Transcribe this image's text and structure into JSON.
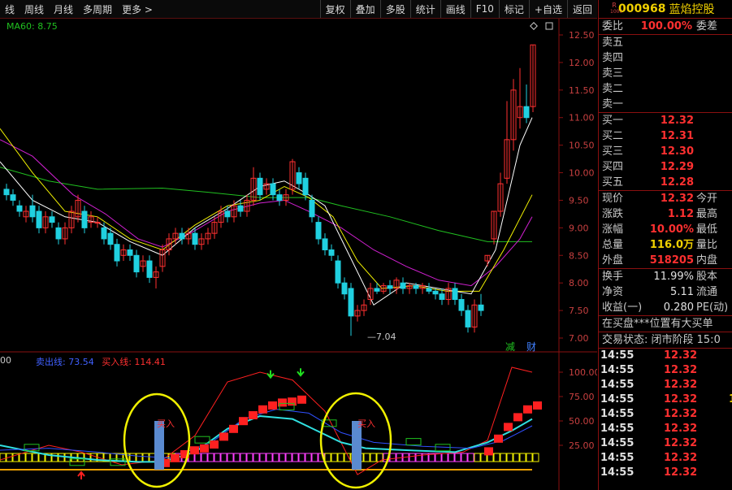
{
  "toolbar": {
    "left": [
      "线",
      "周线",
      "月线",
      "多周期",
      "更多 >"
    ],
    "right": [
      "复权",
      "叠加",
      "多股",
      "统计",
      "画线",
      "F10",
      "标记",
      "+自选",
      "返回"
    ]
  },
  "chart": {
    "ma60_label": "MA60: 8.75",
    "price_axis": [
      "12.50",
      "12.00",
      "11.50",
      "11.00",
      "10.50",
      "10.00",
      "9.50",
      "9.00",
      "8.50",
      "8.00",
      "7.50",
      "7.00"
    ],
    "low_marker": "7.04",
    "badges": {
      "jian": "减",
      "cai": "财"
    },
    "indicator_prefix": "00",
    "indicator_sell": "卖出线: 73.54",
    "indicator_buy": "买入线: 114.41",
    "ind_axis": [
      "100.00",
      "75.00",
      "50.00",
      "25.00"
    ],
    "buy_label": "买入",
    "colors": {
      "up": "#ff3030",
      "down": "#20d0e0",
      "ma5": "#ffffff",
      "ma10": "#f0f000",
      "ma20": "#d020d0",
      "ma60": "#20c020"
    }
  },
  "quote": {
    "r_badge": "R",
    "r_badge_sub": "1000",
    "code": "000968",
    "name": "蓝焰控股",
    "weibi_label": "委比",
    "weibi_value": "100.00%",
    "weicha_label": "委差",
    "sell": [
      {
        "label": "卖五"
      },
      {
        "label": "卖四"
      },
      {
        "label": "卖三"
      },
      {
        "label": "卖二"
      },
      {
        "label": "卖一"
      }
    ],
    "buy": [
      {
        "label": "买一",
        "price": "12.32"
      },
      {
        "label": "买二",
        "price": "12.31"
      },
      {
        "label": "买三",
        "price": "12.30"
      },
      {
        "label": "买四",
        "price": "12.29"
      },
      {
        "label": "买五",
        "price": "12.28"
      }
    ],
    "stats": [
      {
        "k": "现价",
        "v": "12.32",
        "k2": "今开"
      },
      {
        "k": "涨跌",
        "v": "1.12",
        "k2": "最高"
      },
      {
        "k": "涨幅",
        "v": "10.00%",
        "k2": "最低"
      },
      {
        "k": "总量",
        "v": "116.0万",
        "k2": "量比"
      },
      {
        "k": "外盘",
        "v": "518205",
        "k2": "内盘"
      }
    ],
    "stats2": [
      {
        "k": "换手",
        "v": "11.99%",
        "k2": "股本"
      },
      {
        "k": "净资",
        "v": "5.11",
        "k2": "流通"
      },
      {
        "k": "收益(一)",
        "v": "0.280",
        "k2": "PE(动)"
      }
    ],
    "notice1": "在买盘***位置有大买单",
    "notice2": "交易状态: 闭市阶段 15:0",
    "ticks": [
      {
        "t": "14:55",
        "p": "12.32",
        "q": ""
      },
      {
        "t": "14:55",
        "p": "12.32",
        "q": ""
      },
      {
        "t": "14:55",
        "p": "12.32",
        "q": ""
      },
      {
        "t": "14:55",
        "p": "12.32",
        "q": "1"
      },
      {
        "t": "14:55",
        "p": "12.32",
        "q": ""
      },
      {
        "t": "14:55",
        "p": "12.32",
        "q": ""
      },
      {
        "t": "14:55",
        "p": "12.32",
        "q": ""
      },
      {
        "t": "14:55",
        "p": "12.32",
        "q": ""
      },
      {
        "t": "14:55",
        "p": "12.32",
        "q": ""
      }
    ]
  }
}
